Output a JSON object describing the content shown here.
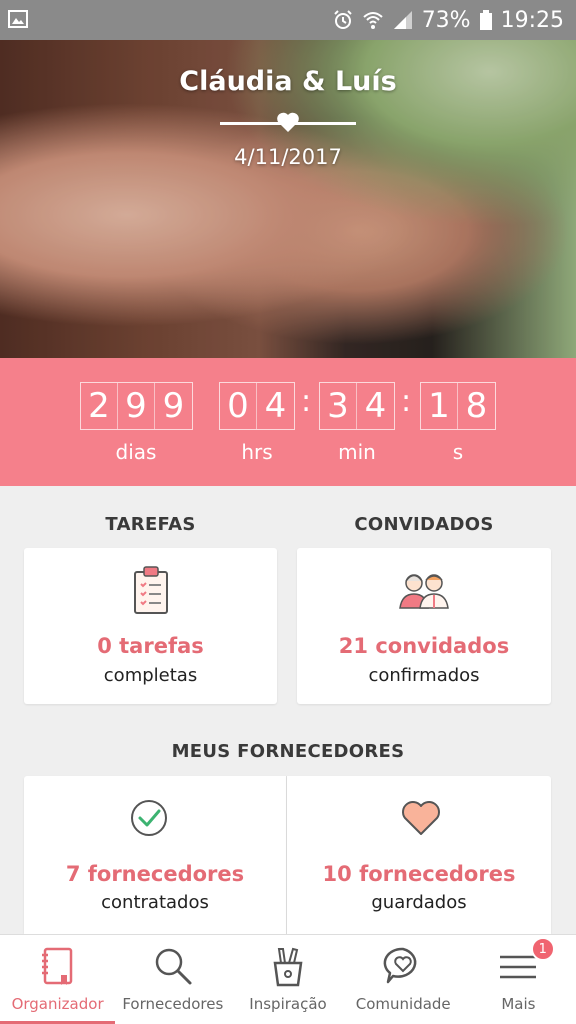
{
  "status_bar": {
    "battery": "73%",
    "time": "19:25",
    "icons": [
      "image-icon",
      "alarm-icon",
      "wifi-icon",
      "signal-icon",
      "battery-icon"
    ]
  },
  "hero": {
    "title": "Cláudia & Luís",
    "date": "4/11/2017"
  },
  "countdown": {
    "days": [
      "2",
      "9",
      "9"
    ],
    "hours": [
      "0",
      "4"
    ],
    "minutes": [
      "3",
      "4"
    ],
    "seconds": [
      "1",
      "8"
    ],
    "labels": {
      "days": "dias",
      "hours": "hrs",
      "minutes": "min",
      "seconds": "s"
    },
    "separator": ":"
  },
  "tasks": {
    "title": "TAREFAS",
    "main": "0 tarefas",
    "sub": "completas",
    "icon": "clipboard-icon"
  },
  "guests": {
    "title": "CONVIDADOS",
    "main": "21 convidados",
    "sub": "confirmados",
    "icon": "guests-icon"
  },
  "vendors": {
    "title": "MEUS FORNECEDORES",
    "hired": {
      "main": "7 fornecedores",
      "sub": "contratados",
      "icon": "check-circle-icon"
    },
    "saved": {
      "main": "10 fornecedores",
      "sub": "guardados",
      "icon": "heart-icon"
    }
  },
  "nav": {
    "items": [
      {
        "label": "Organizador",
        "icon": "notebook-icon",
        "active": true
      },
      {
        "label": "Fornecedores",
        "icon": "search-icon"
      },
      {
        "label": "Inspiração",
        "icon": "pencil-cup-icon"
      },
      {
        "label": "Comunidade",
        "icon": "chat-heart-icon"
      },
      {
        "label": "Mais",
        "icon": "menu-icon",
        "badge": "1"
      }
    ]
  },
  "colors": {
    "accent": "#e46b75",
    "countdown_bg": "#f5808b",
    "status_bar": "#8a8a8a"
  }
}
